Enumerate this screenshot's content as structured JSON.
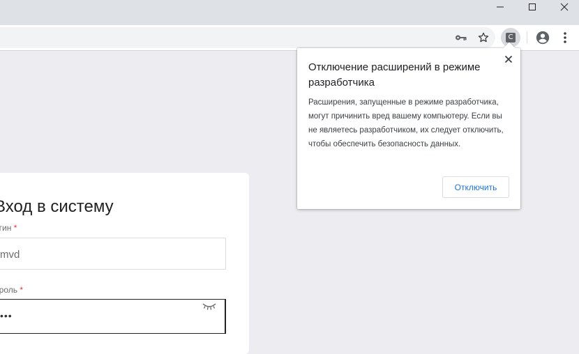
{
  "browser": {
    "window_controls": {
      "minimize_icon": "minimize-icon",
      "maximize_icon": "maximize-icon",
      "close_icon": "close-icon"
    },
    "toolbar": {
      "extension_badge": "C",
      "icons": [
        "key-icon",
        "star-icon",
        "account-icon",
        "kebab-menu-icon"
      ]
    }
  },
  "popup": {
    "title": "Отключение расширений в режиме разработчика",
    "body": "Расширения, запущенные в режиме разработчика, могут причинить вред вашему компьютеру. Если вы не являетесь разработчиком, их следует отключить, чтобы обеспечить безопасность данных.",
    "button_label": "Отключить",
    "close_icon": "close-icon"
  },
  "login": {
    "title": "Вход в систему",
    "login_label": "огин",
    "password_label": "ароль",
    "required_mark": "*",
    "login_value": "mvd",
    "password_value": "•••",
    "eye_icon": "eye-closed-icon"
  },
  "colors": {
    "accent": "#1a73e8",
    "required": "#e53935",
    "page_background": "#ececf1"
  }
}
